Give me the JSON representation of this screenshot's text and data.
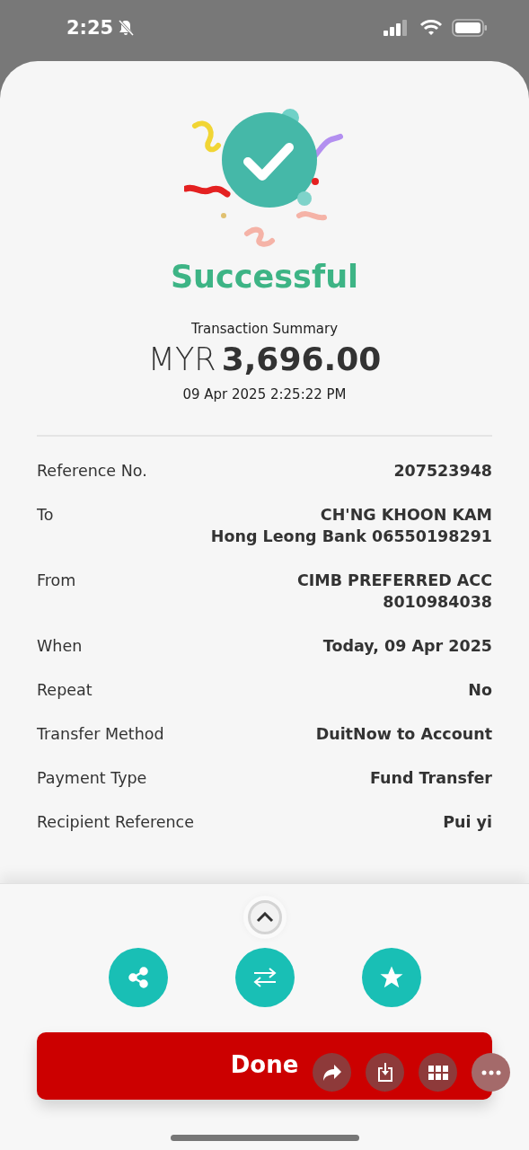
{
  "status_bar": {
    "time": "2:25",
    "silent": true
  },
  "result": {
    "title": "Successful",
    "summary_label": "Transaction Summary",
    "currency": "MYR",
    "amount": "3,696.00",
    "datetime": "09 Apr 2025 2:25:22 PM"
  },
  "details": [
    {
      "label": "Reference No.",
      "values": [
        "207523948"
      ]
    },
    {
      "label": "To",
      "values": [
        "CH'NG KHOON KAM",
        "Hong Leong Bank 06550198291"
      ]
    },
    {
      "label": "From",
      "values": [
        "CIMB PREFERRED ACC",
        "8010984038"
      ]
    },
    {
      "label": "When",
      "values": [
        "Today, 09 Apr 2025"
      ]
    },
    {
      "label": "Repeat",
      "values": [
        "No"
      ]
    },
    {
      "label": "Transfer Method",
      "values": [
        "DuitNow to Account"
      ]
    },
    {
      "label": "Payment Type",
      "values": [
        "Fund Transfer"
      ]
    },
    {
      "label": "Recipient Reference",
      "values": [
        "Pui yi"
      ]
    }
  ],
  "actions": [
    {
      "kind": "share"
    },
    {
      "kind": "transfer"
    },
    {
      "kind": "favourite"
    }
  ],
  "done_button": {
    "label": "Done"
  },
  "floating_tools": [
    {
      "kind": "forward"
    },
    {
      "kind": "download"
    },
    {
      "kind": "grid"
    },
    {
      "kind": "more"
    }
  ]
}
